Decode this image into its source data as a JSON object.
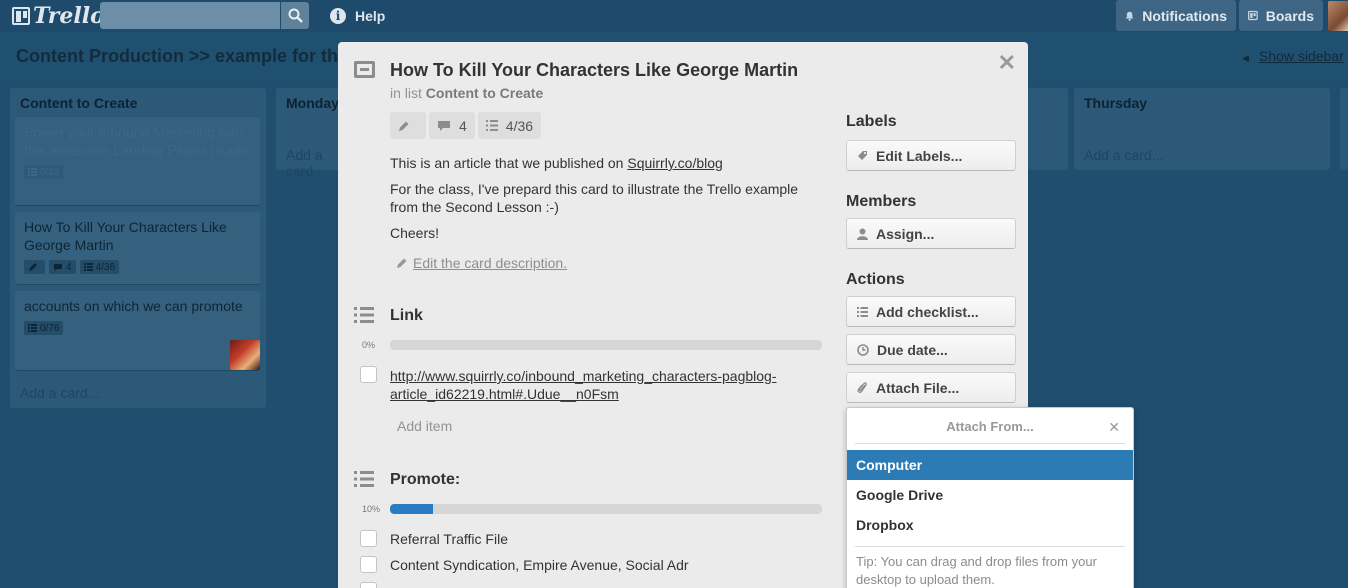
{
  "header": {
    "logo_text": "Trello",
    "search_placeholder": "",
    "help_label": "Help",
    "notifications_label": "Notifications",
    "boards_label": "Boards"
  },
  "board": {
    "title": "Content Production >> example for th",
    "show_sidebar": "Show sidebar"
  },
  "lists": [
    {
      "title": "Content to Create",
      "cards": [
        {
          "text": "Power your Inbound Marketing with this awesome Landing Pages plugin",
          "checklist": "0/12"
        },
        {
          "text": "How To Kill Your Characters Like George Martin",
          "comments": "4",
          "checklist": "4/36"
        },
        {
          "text": "accounts on which we can promote",
          "checklist": "0/76"
        }
      ],
      "add_card": "Add a card..."
    },
    {
      "title": "Monday",
      "add_card": "Add a card..."
    },
    {
      "title": "Thursday",
      "add_card": "Add a card..."
    }
  ],
  "dialog": {
    "title": "How To Kill Your Characters Like George Martin",
    "in_list_prefix": "in list",
    "list_name": "Content to Create",
    "badge_comments": "4",
    "badge_checklist": "4/36",
    "desc_line1_prefix": "This is an article that we published on",
    "desc_line1_link": "Squirrly.co/blog",
    "desc_line2": "For the class, I've prepard this card to illustrate the Trello example from the Second Lesson :-)",
    "desc_line3": "Cheers!",
    "edit_description": "Edit the card description.",
    "checklists": [
      {
        "title": "Link",
        "percent_label": "0%",
        "progress": 0,
        "items": [
          "http://www.squirrly.co/inbound_marketing_characters-pagblog-",
          "article_id62219.html#.Udue__n0Fsm"
        ],
        "add_item": "Add item"
      },
      {
        "title": "Promote:",
        "percent_label": "10%",
        "progress": 0.1,
        "items": [
          "Referral Traffic File",
          "Content Syndication, Empire Avenue, Social Adr"
        ]
      }
    ],
    "sidebar": {
      "labels_heading": "Labels",
      "edit_labels": "Edit Labels...",
      "members_heading": "Members",
      "assign": "Assign...",
      "actions_heading": "Actions",
      "add_checklist": "Add checklist...",
      "due_date": "Due date...",
      "attach_file": "Attach File..."
    }
  },
  "attach_popover": {
    "title": "Attach From...",
    "options": [
      "Computer",
      "Google Drive",
      "Dropbox"
    ],
    "selected": "Computer",
    "tip": "Tip: You can drag and drop files from your desktop to upload them."
  }
}
